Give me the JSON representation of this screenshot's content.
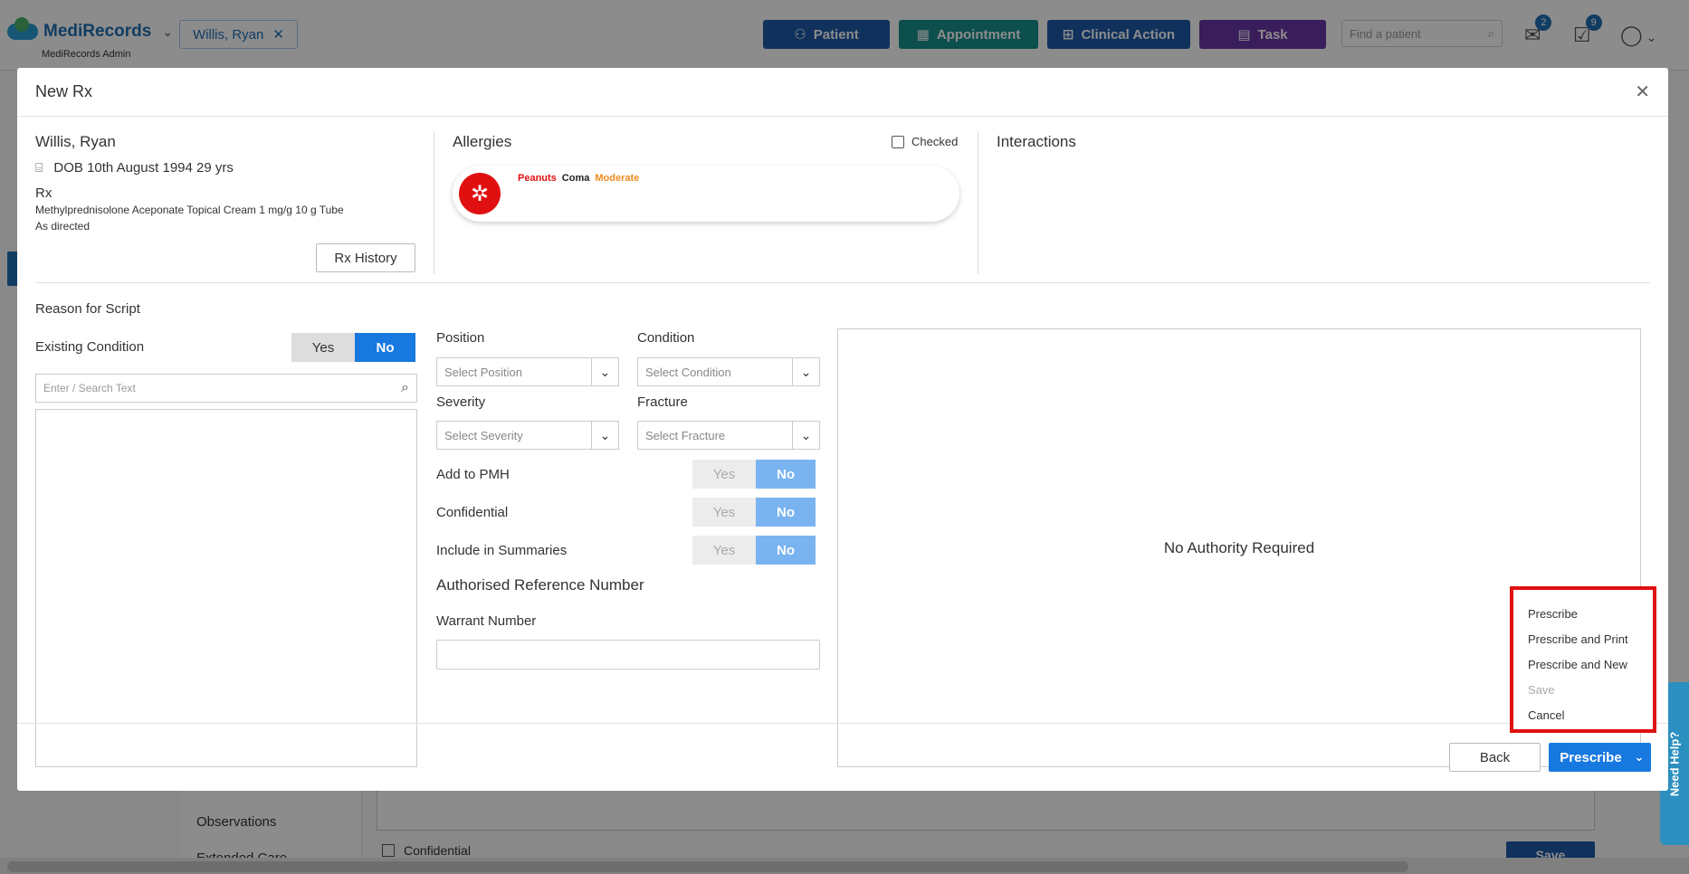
{
  "app": {
    "brand": "MediRecords",
    "admin_label": "MediRecords Admin",
    "patient_tab": "Willis, Ryan",
    "nav": {
      "patient": "Patient",
      "appointment": "Appointment",
      "clinical_action": "Clinical Action",
      "task": "Task"
    },
    "find_patient_placeholder": "Find a patient",
    "mail_count": "2",
    "task_count": "9"
  },
  "background": {
    "sidebar_items": [
      "Observations",
      "Extended Care"
    ],
    "confidential_label": "Confidential",
    "save_label": "Save",
    "need_help": "Need Help?"
  },
  "modal": {
    "title": "New Rx",
    "patient": {
      "name": "Willis, Ryan",
      "dob": "DOB 10th August 1994 29 yrs",
      "rx_heading": "Rx",
      "rx_drug": "Methylprednisolone Aceponate Topical Cream 1 mg/g 10 g Tube",
      "rx_directions": "As directed",
      "rx_history_button": "Rx History"
    },
    "allergies": {
      "heading": "Allergies",
      "checked_label": "Checked",
      "item": {
        "allergen": "Peanuts",
        "reaction": "Coma",
        "severity": "Moderate"
      }
    },
    "interactions": {
      "heading": "Interactions"
    },
    "reason": {
      "heading": "Reason for Script",
      "existing_condition": "Existing Condition",
      "yes": "Yes",
      "no": "No",
      "search_placeholder": "Enter / Search Text"
    },
    "fields": {
      "position_label": "Position",
      "position_placeholder": "Select Position",
      "condition_label": "Condition",
      "condition_placeholder": "Select Condition",
      "severity_label": "Severity",
      "severity_placeholder": "Select Severity",
      "fracture_label": "Fracture",
      "fracture_placeholder": "Select Fracture",
      "add_to_pmh": "Add to PMH",
      "confidential": "Confidential",
      "include_in_summaries": "Include in Summaries",
      "yes": "Yes",
      "no": "No",
      "authorised_reference_number": "Authorised Reference Number",
      "warrant_number": "Warrant Number"
    },
    "authority_text": "No Authority Required",
    "dropdown": {
      "prescribe": "Prescribe",
      "prescribe_and_print": "Prescribe and Print",
      "prescribe_and_new": "Prescribe and New",
      "save": "Save",
      "cancel": "Cancel"
    },
    "footer": {
      "back": "Back",
      "prescribe": "Prescribe"
    }
  },
  "colors": {
    "patient_btn": "#1e5aa8",
    "appointment_btn": "#17918a",
    "clinical_action_btn": "#1e5aa8",
    "task_btn": "#6a35a6",
    "primary": "#1778e0",
    "allergen_red": "#e01010",
    "severity_orange": "#f08a1c",
    "highlight_box": "#e01010"
  }
}
